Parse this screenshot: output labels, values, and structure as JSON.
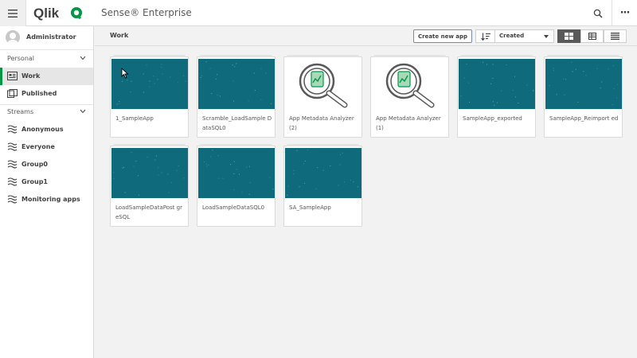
{
  "header": {
    "logo_text": "Qlik",
    "app_title": "Sense® Enterprise",
    "menu_icon": "hamburger-icon",
    "search_icon": "search-icon",
    "more_icon": "more-icon",
    "more_label": "···"
  },
  "sidebar": {
    "user": {
      "name": "Administrator",
      "icon": "user-avatar-icon"
    },
    "personal": {
      "label": "Personal",
      "items": [
        {
          "label": "Work",
          "icon": "work-icon",
          "active": true
        },
        {
          "label": "Published",
          "icon": "published-icon",
          "active": false
        }
      ]
    },
    "streams": {
      "label": "Streams",
      "items": [
        {
          "label": "Anonymous",
          "icon": "stream-icon"
        },
        {
          "label": "Everyone",
          "icon": "stream-icon"
        },
        {
          "label": "Group0",
          "icon": "stream-icon"
        },
        {
          "label": "Group1",
          "icon": "stream-icon"
        },
        {
          "label": "Monitoring apps",
          "icon": "stream-icon"
        }
      ]
    }
  },
  "main": {
    "title": "Work",
    "create_button": "Create new app",
    "sort": {
      "icon": "sort-icon",
      "value": "Created"
    },
    "view_modes": [
      {
        "icon": "grid-view-icon",
        "active": true
      },
      {
        "icon": "table-view-icon",
        "active": false
      },
      {
        "icon": "list-view-icon",
        "active": false
      }
    ],
    "apps": [
      {
        "name": "1_SampleApp",
        "thumbnail": "teal"
      },
      {
        "name": "Scramble_LoadSample DataSQL0",
        "thumbnail": "teal"
      },
      {
        "name": "App Metadata Analyzer(2)",
        "thumbnail": "magnifier"
      },
      {
        "name": "App Metadata Analyzer(1)",
        "thumbnail": "magnifier"
      },
      {
        "name": "SampleApp_exported",
        "thumbnail": "teal"
      },
      {
        "name": "SampleApp_Reimport ed",
        "thumbnail": "teal"
      },
      {
        "name": "LoadSampleDataPost greSQL",
        "thumbnail": "teal"
      },
      {
        "name": "LoadSampleDataSQL0",
        "thumbnail": "teal"
      },
      {
        "name": "SA_SampleApp",
        "thumbnail": "teal"
      }
    ]
  },
  "colors": {
    "accent_green": "#009845",
    "thumbnail_teal": "#0f6b7c",
    "active_view_button": "#595959"
  }
}
